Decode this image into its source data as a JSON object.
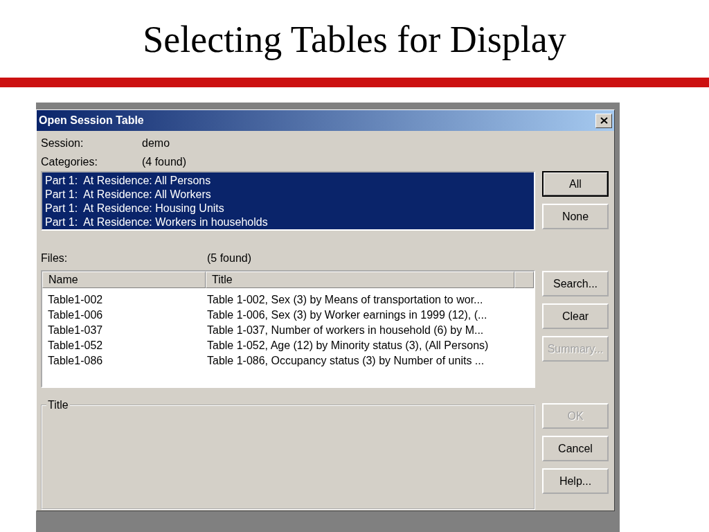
{
  "slide": {
    "title": "Selecting Tables for Display"
  },
  "window": {
    "title": "Open Session Table"
  },
  "session": {
    "label": "Session:",
    "value": "demo"
  },
  "categories": {
    "label": "Categories:",
    "count": "(4 found)",
    "items": [
      {
        "text": "Part 1:  At Residence: All Persons",
        "selected": true
      },
      {
        "text": "Part 1:  At Residence: All Workers",
        "selected": true
      },
      {
        "text": "Part 1:  At Residence: Housing Units",
        "selected": true
      },
      {
        "text": "Part 1:  At Residence: Workers in households",
        "selected": true
      }
    ],
    "buttons": [
      {
        "label": "All",
        "default": true,
        "disabled": false
      },
      {
        "label": "None",
        "default": false,
        "disabled": false
      }
    ]
  },
  "files": {
    "label": "Files:",
    "count": "(5 found)",
    "columns": [
      "Name",
      "Title"
    ],
    "rows": [
      [
        "Table1-002",
        "Table 1-002, Sex (3) by Means of transportation to wor..."
      ],
      [
        "Table1-006",
        "Table 1-006, Sex (3) by Worker earnings in 1999 (12), (..."
      ],
      [
        "Table1-037",
        "Table 1-037, Number of workers in household (6) by M..."
      ],
      [
        "Table1-052",
        "Table 1-052, Age (12) by Minority status (3), (All Persons)"
      ],
      [
        "Table1-086",
        "Table 1-086, Occupancy status (3) by Number of units ..."
      ]
    ],
    "buttons": [
      {
        "label": "Search...",
        "default": false,
        "disabled": false
      },
      {
        "label": "Clear",
        "default": false,
        "disabled": false
      },
      {
        "label": "Summary...",
        "default": false,
        "disabled": true
      }
    ]
  },
  "title_group": {
    "label": "Title"
  },
  "buttons": [
    {
      "label": "OK",
      "default": false,
      "disabled": true
    },
    {
      "label": "Cancel",
      "default": false,
      "disabled": false
    },
    {
      "label": "Help...",
      "default": false,
      "disabled": false
    }
  ]
}
